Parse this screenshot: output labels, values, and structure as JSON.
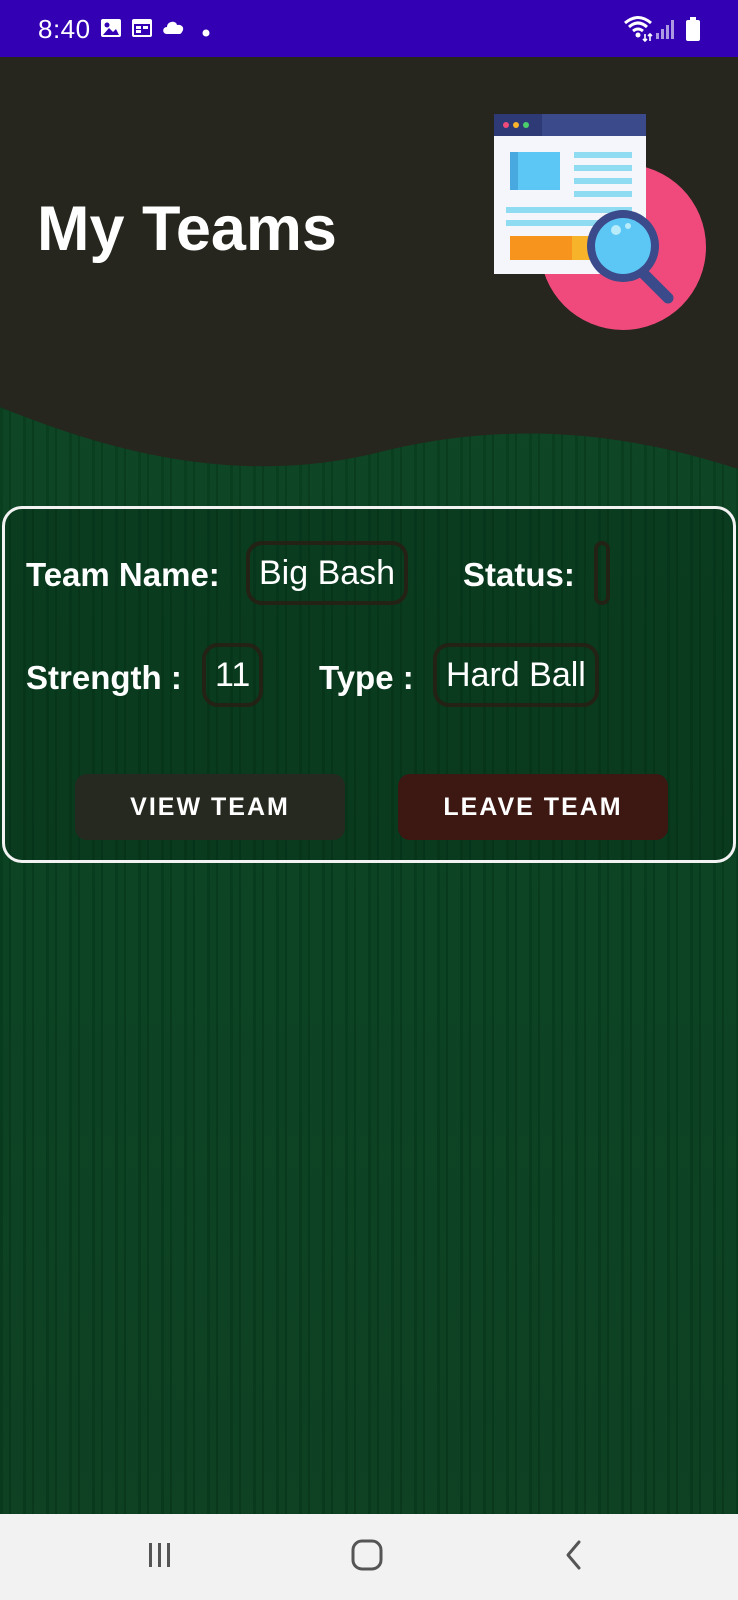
{
  "status_bar": {
    "time": "8:40",
    "left_icons": [
      "image-icon",
      "calendar-icon",
      "cloud-icon",
      "dot-icon"
    ],
    "right_icons": [
      "wifi-icon",
      "signal-icon",
      "battery-icon"
    ]
  },
  "header": {
    "title": "My Teams",
    "illustration": "web-search-illustration"
  },
  "team_card": {
    "team_name_label": "Team Name:",
    "team_name_value": "Big Bash",
    "status_label": "Status:",
    "status_value": "",
    "strength_label": "Strength :",
    "strength_value": "11",
    "type_label": "Type :",
    "type_value": "Hard Ball",
    "view_button": "VIEW TEAM",
    "leave_button": "LEAVE TEAM"
  },
  "nav_bar": {
    "buttons": [
      "recent-apps-icon",
      "home-icon",
      "back-icon"
    ]
  },
  "colors": {
    "status_bar": "#3300b4",
    "header": "#26261e",
    "background": "#0a4221",
    "card_border": "#f2f2f2",
    "view_button": "#26291f",
    "leave_button": "#3d1712",
    "nav_bar": "#f2f2f2"
  }
}
